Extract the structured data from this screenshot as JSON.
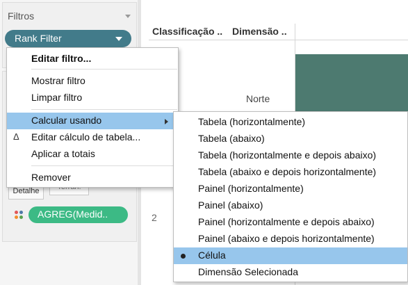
{
  "filters": {
    "title": "Filtros",
    "rank_filter_label": "Rank Filter"
  },
  "marks": {
    "detail_label": "Detalhe",
    "tooltip_label": "Terran.",
    "agg_pill_label": "AGREG(Medid.."
  },
  "view": {
    "col_headers": [
      "Classificação ..",
      "Dimensão .."
    ],
    "row_label": "Norte",
    "row_number": "2"
  },
  "colors": {
    "accent_teal": "#427b8a",
    "agg_green": "#3cba85",
    "mark_fill": "#4d7a70",
    "menu_highlight": "#97c6ec"
  },
  "context_menu": {
    "items": [
      "Editar filtro...",
      "Mostrar filtro",
      "Limpar filtro",
      "Calcular usando",
      "Editar cálculo de tabela...",
      "Aplicar a totais",
      "Remover"
    ],
    "delta_icon": "Δ"
  },
  "submenu": {
    "items": [
      "Tabela (horizontalmente)",
      "Tabela (abaixo)",
      "Tabela (horizontalmente e depois abaixo)",
      "Tabela (abaixo e depois horizontalmente)",
      "Painel (horizontalmente)",
      "Painel (abaixo)",
      "Painel (horizontalmente e depois abaixo)",
      "Painel (abaixo e depois horizontalmente)",
      "Célula",
      "Dimensão Selecionada"
    ],
    "selected": "Célula"
  }
}
